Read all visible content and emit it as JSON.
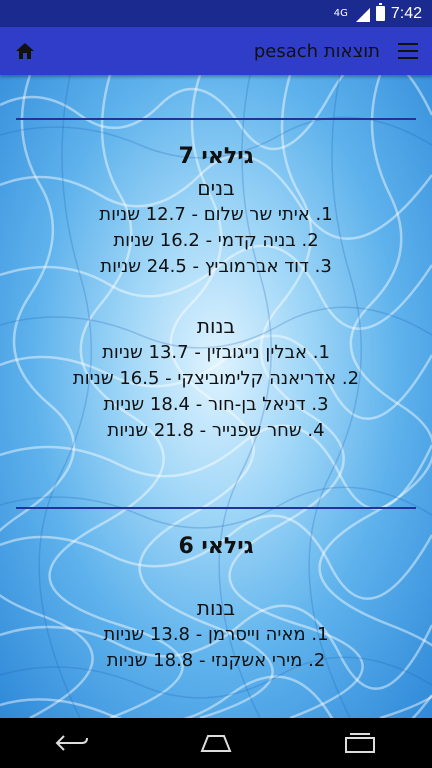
{
  "status_bar": {
    "network": "4G",
    "time": "7:42"
  },
  "app_bar": {
    "title": "תוצאות pesach"
  },
  "categories": [
    {
      "age_title": "גילאי 7",
      "groups": [
        {
          "title": "בנים",
          "results": [
            "1. איתי שר שלום - 12.7 שניות",
            "2. בניה קדמי - 16.2 שניות",
            "3. דוד אברמוביץ - 24.5 שניות"
          ]
        },
        {
          "title": "בנות",
          "results": [
            "1. אבלין נייגובזין - 13.7 שניות",
            "2. אדריאנה קלימוביצקי - 16.5 שניות",
            "3. דניאל בן-חור - 18.4 שניות",
            "4. שחר שפנייר - 21.8 שניות"
          ]
        }
      ]
    },
    {
      "age_title": "גילאי 6",
      "groups": [
        {
          "title": "בנות",
          "results": [
            "1. מאיה וייסרמן - 13.8 שניות",
            "2. מירי אשקנזי - 18.8 שניות"
          ]
        }
      ]
    }
  ],
  "colors": {
    "status_bar": "#1b2a8f",
    "app_bar": "#2f3dc9",
    "divider": "#22339b"
  }
}
